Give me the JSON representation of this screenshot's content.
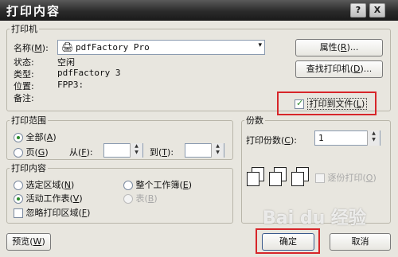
{
  "window": {
    "title": "打印内容",
    "help_label": "?",
    "close_label": "X"
  },
  "printer": {
    "group_label": "打印机",
    "name_label": "名称(",
    "name_key": "M",
    "name_suffix": "):",
    "name_value": "pdfFactory Pro",
    "status_label": "状态:",
    "status_value": "空闲",
    "type_label": "类型:",
    "type_value": "pdfFactory 3",
    "location_label": "位置:",
    "location_value": "FPP3:",
    "comment_label": "备注:",
    "comment_value": "",
    "properties_label": "属性(",
    "properties_key": "R",
    "properties_suffix": ")...",
    "find_label": "查找打印机(",
    "find_key": "D",
    "find_suffix": ")...",
    "print_to_file_label": "打印到文件(",
    "print_to_file_key": "L",
    "print_to_file_suffix": ")",
    "print_to_file_checked": true
  },
  "range": {
    "group_label": "打印范围",
    "all_label": "全部(",
    "all_key": "A",
    "all_suffix": ")",
    "pages_label": "页(",
    "pages_key": "G",
    "pages_suffix": ")",
    "from_label": "从(",
    "from_key": "F",
    "from_suffix": "):",
    "from_value": "",
    "to_label": "到(",
    "to_key": "T",
    "to_suffix": "):",
    "to_value": "",
    "selected": "all"
  },
  "content": {
    "group_label": "打印内容",
    "selection_label": "选定区域(",
    "selection_key": "N",
    "selection_suffix": ")",
    "workbook_label": "整个工作簿(",
    "workbook_key": "E",
    "workbook_suffix": ")",
    "active_label": "活动工作表(",
    "active_key": "V",
    "active_suffix": ")",
    "table_label": "表(",
    "table_key": "B",
    "table_suffix": ")",
    "ignore_label": "忽略打印区域(",
    "ignore_key": "F",
    "ignore_suffix": ")",
    "selected": "active"
  },
  "copies": {
    "group_label": "份数",
    "count_label": "打印份数(",
    "count_key": "C",
    "count_suffix": "):",
    "count_value": "1",
    "collate_label": "逐份打印(",
    "collate_key": "O",
    "collate_suffix": ")"
  },
  "footer": {
    "preview_label": "预览(",
    "preview_key": "W",
    "preview_suffix": ")",
    "ok_label": "确定",
    "cancel_label": "取消"
  },
  "watermark": {
    "text": "Bai du 经验"
  }
}
